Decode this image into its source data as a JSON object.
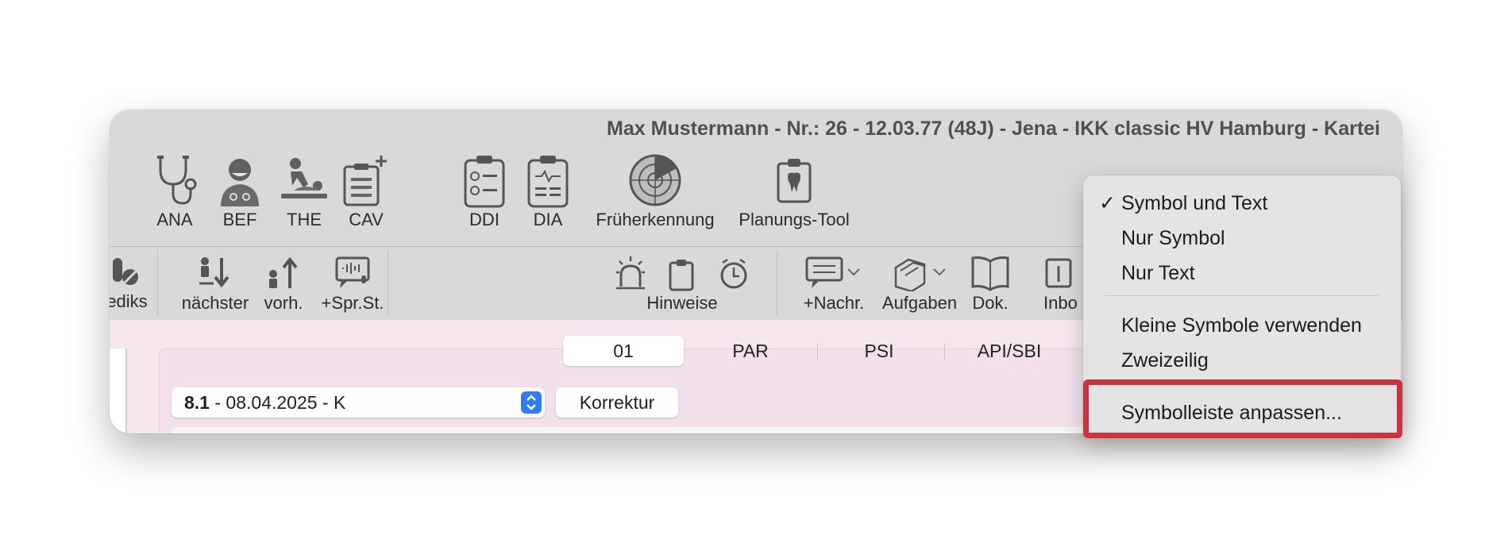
{
  "window": {
    "title": "Max Mustermann - Nr.: 26 - 12.03.77 (48J) - Jena - IKK classic HV Hamburg - Kartei"
  },
  "toolbar_row1": [
    {
      "label": "ANA",
      "icon": "stethoscope-icon"
    },
    {
      "label": "BEF",
      "icon": "doctor-icon"
    },
    {
      "label": "THE",
      "icon": "therapy-icon"
    },
    {
      "label": "CAV",
      "icon": "clipboard-plus-icon"
    },
    {
      "label": "DDI",
      "icon": "checklist-icon"
    },
    {
      "label": "DIA",
      "icon": "diagnosis-clipboard-icon"
    },
    {
      "label": "Früherkennung",
      "icon": "radar-icon"
    },
    {
      "label": "Planungs-Tool",
      "icon": "tooth-clipboard-icon"
    }
  ],
  "toolbar_row2": [
    {
      "label": "ediks",
      "icon": "pills-icon"
    },
    {
      "label": "nächster",
      "icon": "arrow-down-person-icon"
    },
    {
      "label": "vorh.",
      "icon": "arrow-up-person-icon"
    },
    {
      "label": "+Spr.St.",
      "icon": "voice-message-icon"
    },
    {
      "label": "Hinweise",
      "icon": "alarm-light-icon"
    },
    {
      "label": "+Nachr.",
      "icon": "message-icon"
    },
    {
      "label": "Aufgaben",
      "icon": "tasks-icon"
    },
    {
      "label": "Dok.",
      "icon": "book-icon"
    },
    {
      "label": "Inbo",
      "icon": "inbox-icon"
    }
  ],
  "tabs": [
    "01",
    "PAR",
    "PSI",
    "API/SBI"
  ],
  "active_tab": "01",
  "record_select": {
    "bold": "8.1",
    "rest": " - 08.04.2025 - K"
  },
  "korrektur_button": "Korrektur",
  "context_menu": {
    "items": [
      {
        "label": "Symbol und Text",
        "checked": true
      },
      {
        "label": "Nur Symbol",
        "checked": false
      },
      {
        "label": "Nur Text",
        "checked": false
      },
      {
        "label": "Kleine Symbole verwenden",
        "checked": false
      },
      {
        "label": "Zweizeilig",
        "checked": false
      },
      {
        "label": "Symbolleiste anpassen...",
        "checked": false
      }
    ],
    "check_mark": "✓",
    "highlight_color": "#c8343f"
  }
}
